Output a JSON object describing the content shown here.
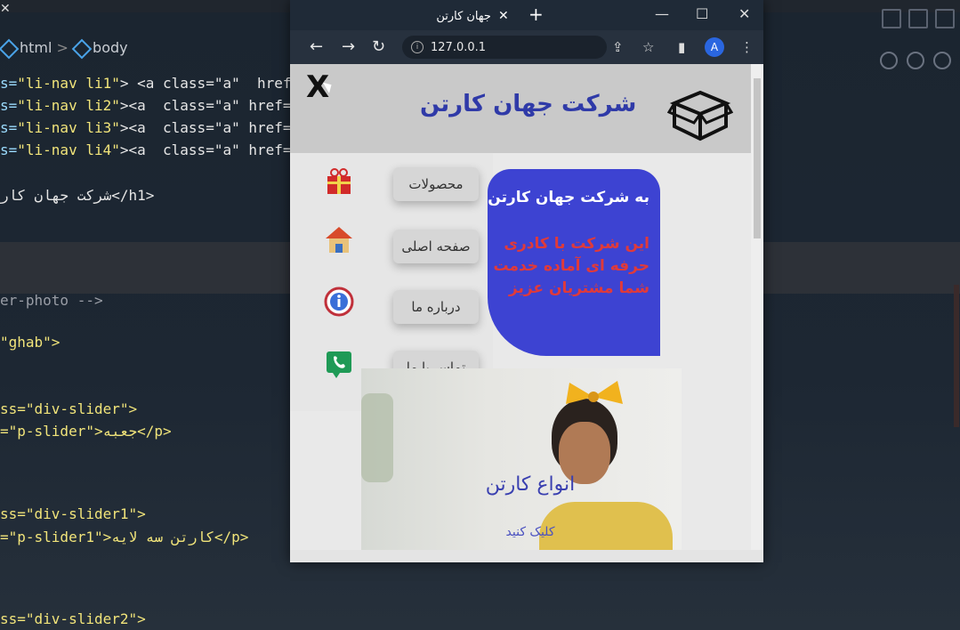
{
  "editor": {
    "breadcrumb": [
      "html",
      "body"
    ],
    "lines": [
      {
        "attr": "s=",
        "val": "\"li-nav li1\"",
        "rest": "> <a class=\"a\"  href=\"#ghab"
      },
      {
        "attr": "s=",
        "val": "\"li-nav li2\"",
        "rest": "><a  class=\"a\" href=\"/index.h"
      },
      {
        "attr": "s=",
        "val": "\"li-nav li3\"",
        "rest": "><a  class=\"a\" href=\"#matn-"
      },
      {
        "attr": "s=",
        "val": "\"li-nav li4\"",
        "rest": "><a  class=\"a\" href=\"#div-fo"
      }
    ],
    "h1_line": "شرکت جهان کار</h1>",
    "comment_line": "er-photo -->",
    "ghab_line": "\"ghab\">",
    "slider_line1": "ss=\"div-slider\">",
    "slider_line2": "=\"p-slider\">جعبه</p>",
    "slider1_line1": "ss=\"div-slider1\">",
    "slider1_line2": "=\"p-slider1\">کارتن سه لایه</p>",
    "slider2_line1": "ss=\"div-slider2\">"
  },
  "browser": {
    "tab_title": "جهان کارتن",
    "tab_close": "✕",
    "new_tab": "+",
    "window_controls": [
      "—",
      "☐",
      "✕"
    ],
    "nav": {
      "back": "←",
      "forward": "→",
      "reload": "↻"
    },
    "address": "127.0.0.1",
    "address_icon": "info-icon",
    "profile_initial": "A"
  },
  "page": {
    "close_label": "X",
    "site_title": "شرکت جهان کارتن",
    "menu": [
      {
        "label": "محصولات",
        "icon": "gift-icon"
      },
      {
        "label": "صفحه اصلی",
        "icon": "home-icon"
      },
      {
        "label": "درباره ما",
        "icon": "info-icon"
      },
      {
        "label": "تماس با ما",
        "icon": "phone-icon"
      }
    ],
    "hero": {
      "title": "به شرکت جهان کارتن",
      "lines": [
        "این شرکت با کادری",
        "حرفه ای آماده خدمت",
        "شما مشتریان عزیز"
      ]
    },
    "card": {
      "title": "انواع کارتن",
      "link": "کلیک کنید"
    }
  },
  "colors": {
    "accent": "#2f3aa8",
    "hero_bg": "#3d43d2",
    "hero_text": "#e03a3a"
  }
}
